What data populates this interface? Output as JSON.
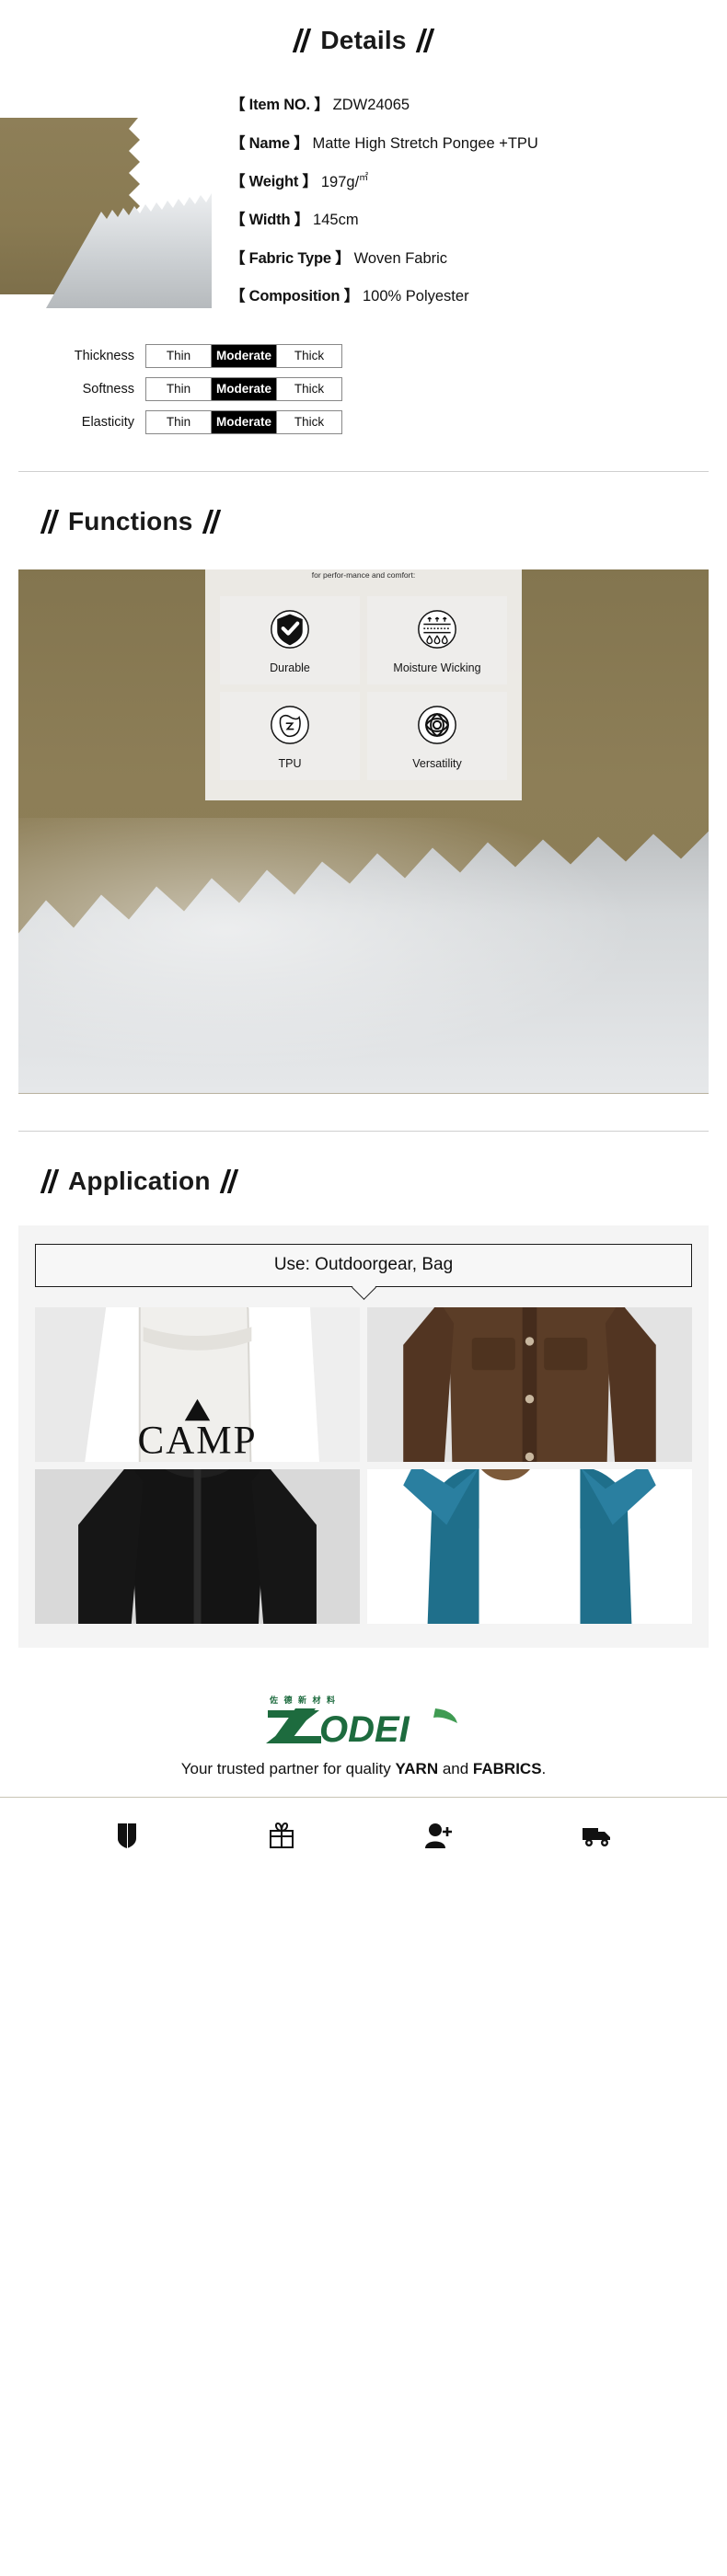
{
  "details": {
    "heading": "Details",
    "specs": [
      {
        "label": "【 Item NO. 】",
        "value": "ZDW24065"
      },
      {
        "label": "【 Name 】",
        "value": "Matte High Stretch Pongee +TPU"
      },
      {
        "label": "【 Weight 】",
        "value": "197g/",
        "unit": "㎡"
      },
      {
        "label": "【 Width 】",
        "value": "145cm"
      },
      {
        "label": "【 Fabric Type 】",
        "value": "Woven Fabric"
      },
      {
        "label": "【 Composition 】",
        "value": "100% Polyester"
      }
    ],
    "ratings": [
      {
        "name": "Thickness",
        "options": [
          "Thin",
          "Moderate",
          "Thick"
        ],
        "selected": "Moderate"
      },
      {
        "name": "Softness",
        "options": [
          "Thin",
          "Moderate",
          "Thick"
        ],
        "selected": "Moderate"
      },
      {
        "name": "Elasticity",
        "options": [
          "Thin",
          "Moderate",
          "Thick"
        ],
        "selected": "Moderate"
      }
    ]
  },
  "functions": {
    "heading": "Functions",
    "description": "The fabric typically offers several key functions tailored for perfor-mance and comfort:",
    "cards": [
      {
        "label": "Durable",
        "icon": "shield-check-icon"
      },
      {
        "label": "Moisture Wicking",
        "icon": "moisture-wicking-icon"
      },
      {
        "label": "TPU",
        "icon": "tpu-icon"
      },
      {
        "label": "Versatility",
        "icon": "versatility-knot-icon"
      }
    ]
  },
  "application": {
    "heading": "Application",
    "use_label": "Use: Outdoorgear, Bag",
    "items": [
      {
        "name": "camp-gear-dry-bag",
        "caption": "CAMP GEAR"
      },
      {
        "name": "brown-quilted-jacket",
        "caption": ""
      },
      {
        "name": "black-softshell-jacket",
        "caption": ""
      },
      {
        "name": "blue-rain-jacket",
        "caption": ""
      }
    ]
  },
  "footer": {
    "logo_text": "ODEI",
    "logo_cn": "佐 德 新 材 料",
    "tagline_prefix": "Your trusted partner for quality ",
    "tagline_yarn": "YARN",
    "tagline_mid": " and ",
    "tagline_fabrics": "FABRICS",
    "tagline_suffix": ".",
    "icons": [
      "shield-icon",
      "gift-icon",
      "user-add-icon",
      "delivery-truck-icon"
    ]
  },
  "colors": {
    "brand_green": "#1d6b3e",
    "fabric_brown": "#8a7b54",
    "fabric_grey": "#d2d5d7",
    "accent_black": "#000000"
  }
}
